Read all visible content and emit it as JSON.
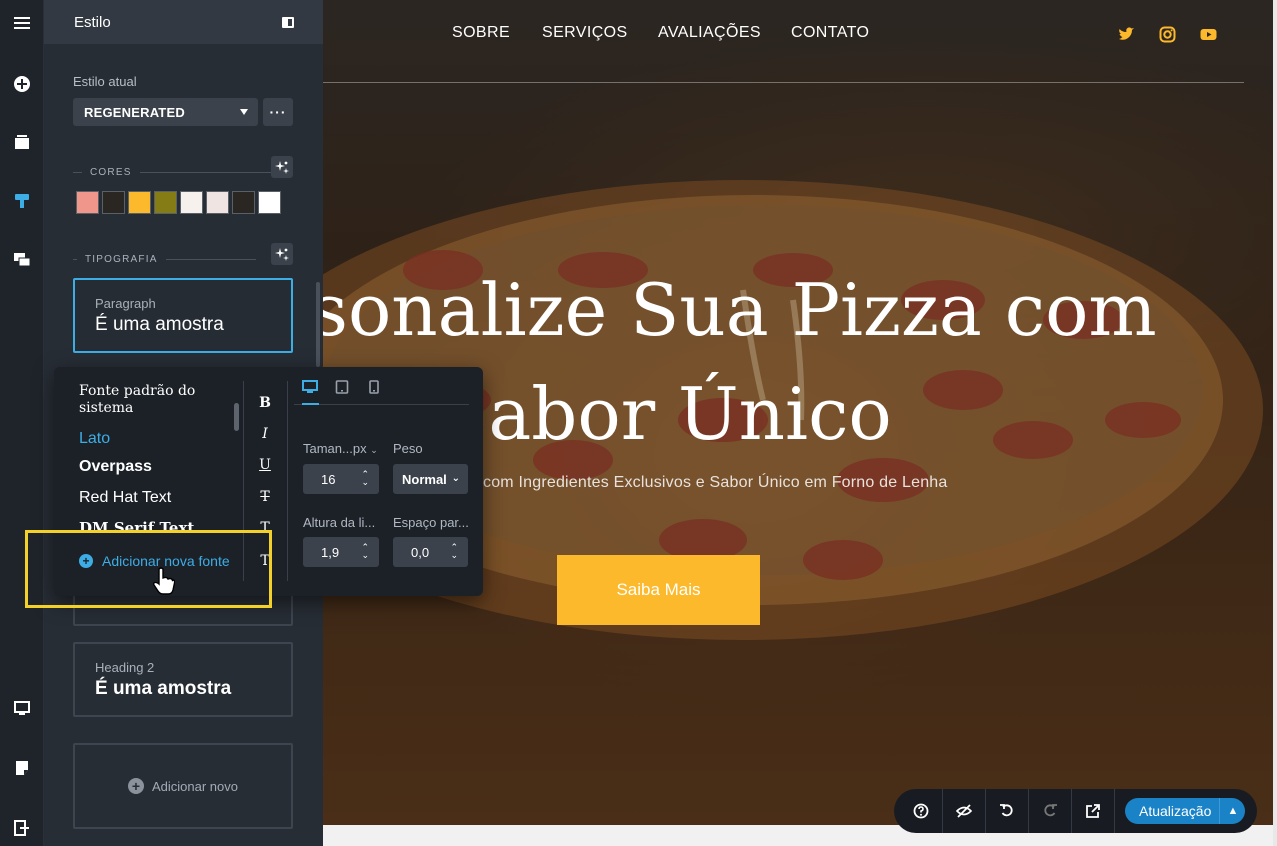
{
  "panel": {
    "title": "Estilo",
    "current_style_label": "Estilo atual",
    "current_style_value": "REGENERATED",
    "more_label": "···",
    "colors_caption": "CORES",
    "typography_caption": "TIPOGRAFIA",
    "swatches": [
      "#f0968a",
      "#2a2723",
      "#fbb92b",
      "#867c16",
      "#f6f1ec",
      "#efe4e2",
      "#2a2723",
      "#ffffff"
    ],
    "typo_cards": [
      {
        "name": "Paragraph",
        "sample": "É uma amostra"
      },
      {
        "name": "Heading 2",
        "sample": "É uma amostra"
      }
    ],
    "add_new_label": "Adicionar novo"
  },
  "font_dropdown": {
    "fonts": [
      "Fonte padrão do sistema",
      "Lato",
      "Overpass",
      "Red Hat Text",
      "DM Serif Text"
    ],
    "selected_font": "Lato",
    "add_font_label": "Adicionar nova fonte",
    "format_buttons": [
      "B",
      "I",
      "U",
      "T",
      "T",
      "T"
    ],
    "size_label": "Taman...px",
    "size_value": "16",
    "weight_label": "Peso",
    "weight_value": "Normal",
    "line_height_label": "Altura da li...",
    "line_height_value": "1,9",
    "letter_spacing_label": "Espaço par...",
    "letter_spacing_value": "0,0"
  },
  "site": {
    "nav": [
      "SOBRE",
      "SERVIÇOS",
      "AVALIAÇÕES",
      "CONTATO"
    ],
    "social_icons": [
      "twitter-icon",
      "instagram-icon",
      "youtube-icon"
    ],
    "accent_color": "#fbb92b",
    "hero_line1": "sonalize Sua Pizza com",
    "hero_line2": "Sabor Único",
    "hero_sub": "com Ingredientes Exclusivos e Sabor Único em Forno de Lenha",
    "cta_label": "Saiba Mais"
  },
  "toolbar": {
    "icons": [
      "help-icon",
      "hide-icon",
      "undo-icon",
      "redo-icon",
      "open-external-icon"
    ],
    "update_label": "Atualização"
  }
}
